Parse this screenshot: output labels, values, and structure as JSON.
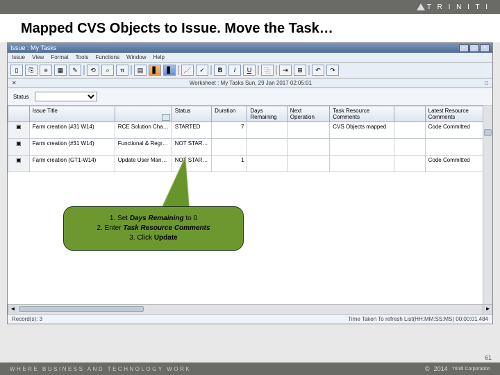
{
  "brand": {
    "name": "T R I N I T I",
    "corp": "Triniti Corporation",
    "tagline": "WHERE BUSINESS AND TECHNOLOGY WORK"
  },
  "slide": {
    "title": "Mapped CVS Objects to Issue. Move the Task…",
    "page": "61",
    "year": "2014",
    "copyright": "©"
  },
  "window": {
    "title": "Issue : My Tasks",
    "menu": [
      "Issue",
      "View",
      "Format",
      "Tools",
      "Functions",
      "Window",
      "Help"
    ],
    "worksheet": "Worksheet : My Tasks Sun, 29 Jan 2017 02:05:01",
    "close_x": "×",
    "min": "–",
    "max": "□",
    "status_label": "Status",
    "status_value": "",
    "columns": [
      "",
      "Issue Title",
      "",
      "Status",
      "Duration",
      "Days Remaining",
      "Next Operation",
      "Task Resource Comments",
      "",
      "Latest Resource Comments"
    ],
    "rows": [
      {
        "title": "Farm creation (#31 W14)",
        "c2": "RCE Solution Changes in CVS",
        "status": "STARTED",
        "duration": "7",
        "days": "",
        "next": "",
        "trc": "CVS Objects mapped",
        "c8": "",
        "latest": "Code Committed"
      },
      {
        "title": "Farm creation (#31 W14)",
        "c2": "Functional & Regression Testing",
        "status": "NOT STARTED",
        "duration": "",
        "days": "",
        "next": "",
        "trc": "",
        "c8": "",
        "latest": ""
      },
      {
        "title": "Farm creation (GT1-W14)",
        "c2": "Update User Manual",
        "status": "NOT STARTED",
        "duration": "1",
        "days": "",
        "next": "",
        "trc": "",
        "c8": "",
        "latest": "Code Committed"
      }
    ],
    "records": "Record(s): 3",
    "timing": "Time Taken To refresh List(HH:MM:SS:MS) 00:00:01.484"
  },
  "callout": {
    "l1_pre": "1. Set ",
    "l1_em": "Days Remaining",
    "l1_post": " to 0",
    "l2_pre": "2. Enter ",
    "l2_em": "Task Resource Comments",
    "l3_pre": "3. Click ",
    "l3_em": "Update"
  }
}
